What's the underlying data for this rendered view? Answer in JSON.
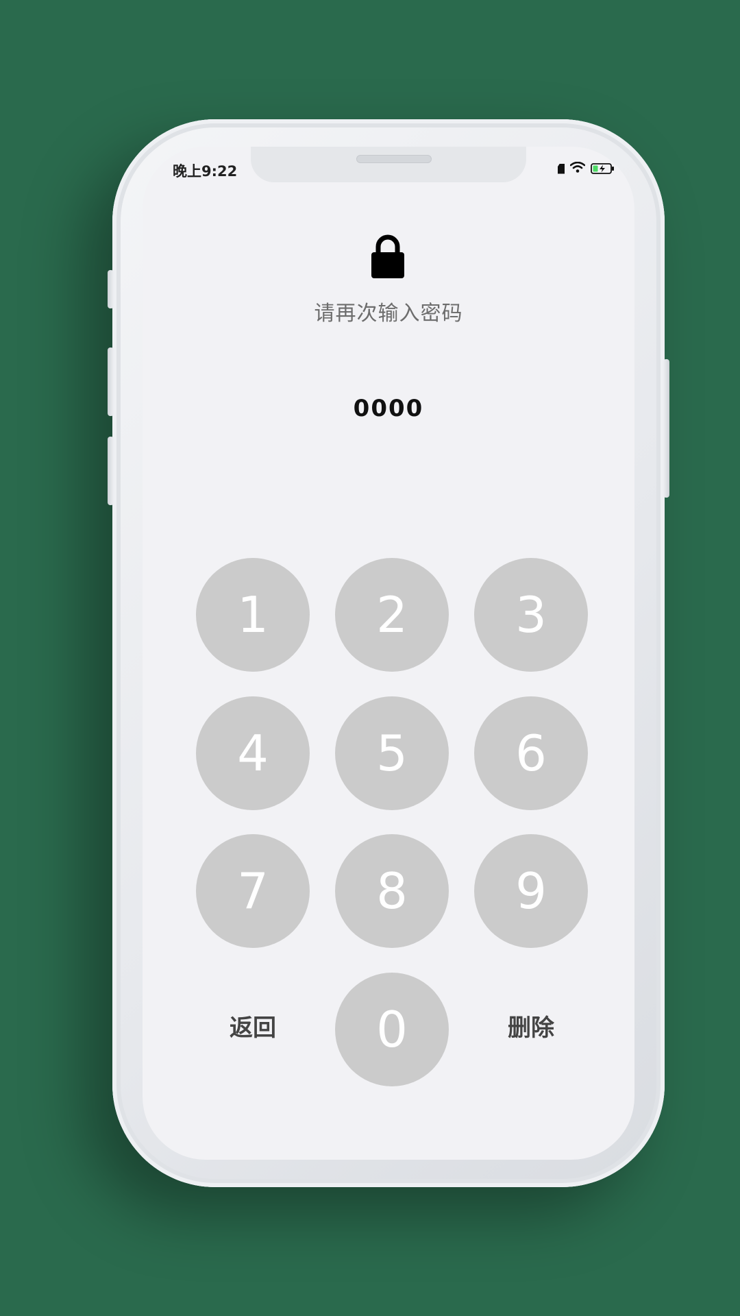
{
  "status_bar": {
    "time": "晚上9:22",
    "icons": [
      "sim-icon",
      "wifi-icon",
      "battery-charging-icon"
    ],
    "battery_color": "#4cd964"
  },
  "lock": {
    "icon": "lock-icon",
    "prompt": "请再次输入密码",
    "entered_code": "0000"
  },
  "keypad": {
    "keys": [
      "1",
      "2",
      "3",
      "4",
      "5",
      "6",
      "7",
      "8",
      "9",
      "0"
    ],
    "back_label": "返回",
    "delete_label": "删除",
    "key_color": "#cbcbcb"
  }
}
